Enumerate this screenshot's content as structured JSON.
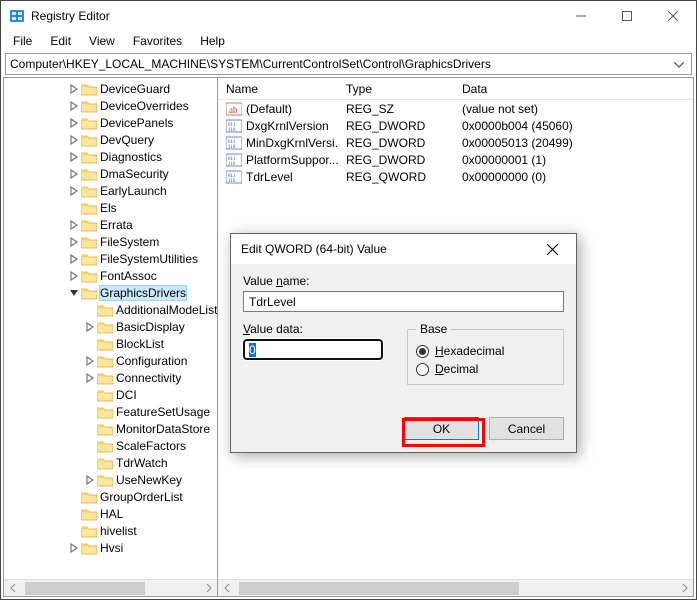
{
  "window": {
    "title": "Registry Editor"
  },
  "menu": {
    "file": "File",
    "edit": "Edit",
    "view": "View",
    "favorites": "Favorites",
    "help": "Help"
  },
  "address": "Computer\\HKEY_LOCAL_MACHINE\\SYSTEM\\CurrentControlSet\\Control\\GraphicsDrivers",
  "tree": [
    {
      "indent": 4,
      "label": "DeviceGuard",
      "twisty": "closed"
    },
    {
      "indent": 4,
      "label": "DeviceOverrides",
      "twisty": "closed"
    },
    {
      "indent": 4,
      "label": "DevicePanels",
      "twisty": "closed"
    },
    {
      "indent": 4,
      "label": "DevQuery",
      "twisty": "closed"
    },
    {
      "indent": 4,
      "label": "Diagnostics",
      "twisty": "closed"
    },
    {
      "indent": 4,
      "label": "DmaSecurity",
      "twisty": "closed"
    },
    {
      "indent": 4,
      "label": "EarlyLaunch",
      "twisty": "closed"
    },
    {
      "indent": 4,
      "label": "Els",
      "twisty": "none"
    },
    {
      "indent": 4,
      "label": "Errata",
      "twisty": "closed"
    },
    {
      "indent": 4,
      "label": "FileSystem",
      "twisty": "closed"
    },
    {
      "indent": 4,
      "label": "FileSystemUtilities",
      "twisty": "closed"
    },
    {
      "indent": 4,
      "label": "FontAssoc",
      "twisty": "closed"
    },
    {
      "indent": 4,
      "label": "GraphicsDrivers",
      "twisty": "open",
      "selected": true
    },
    {
      "indent": 5,
      "label": "AdditionalModeLists",
      "twisty": "none"
    },
    {
      "indent": 5,
      "label": "BasicDisplay",
      "twisty": "closed"
    },
    {
      "indent": 5,
      "label": "BlockList",
      "twisty": "none"
    },
    {
      "indent": 5,
      "label": "Configuration",
      "twisty": "closed"
    },
    {
      "indent": 5,
      "label": "Connectivity",
      "twisty": "closed"
    },
    {
      "indent": 5,
      "label": "DCI",
      "twisty": "none"
    },
    {
      "indent": 5,
      "label": "FeatureSetUsage",
      "twisty": "none"
    },
    {
      "indent": 5,
      "label": "MonitorDataStore",
      "twisty": "none"
    },
    {
      "indent": 5,
      "label": "ScaleFactors",
      "twisty": "none"
    },
    {
      "indent": 5,
      "label": "TdrWatch",
      "twisty": "none"
    },
    {
      "indent": 5,
      "label": "UseNewKey",
      "twisty": "closed"
    },
    {
      "indent": 4,
      "label": "GroupOrderList",
      "twisty": "none"
    },
    {
      "indent": 4,
      "label": "HAL",
      "twisty": "none"
    },
    {
      "indent": 4,
      "label": "hivelist",
      "twisty": "none"
    },
    {
      "indent": 4,
      "label": "Hvsi",
      "twisty": "closed"
    }
  ],
  "list": {
    "cols": {
      "name": "Name",
      "type": "Type",
      "data": "Data"
    },
    "rows": [
      {
        "icon": "str",
        "name": "(Default)",
        "type": "REG_SZ",
        "data": "(value not set)"
      },
      {
        "icon": "bin",
        "name": "DxgKrnlVersion",
        "type": "REG_DWORD",
        "data": "0x0000b004 (45060)"
      },
      {
        "icon": "bin",
        "name": "MinDxgKrnlVersi...",
        "type": "REG_DWORD",
        "data": "0x00005013 (20499)"
      },
      {
        "icon": "bin",
        "name": "PlatformSuppor...",
        "type": "REG_DWORD",
        "data": "0x00000001 (1)"
      },
      {
        "icon": "bin",
        "name": "TdrLevel",
        "type": "REG_QWORD",
        "data": "0x00000000 (0)"
      }
    ]
  },
  "dialog": {
    "title": "Edit QWORD (64-bit) Value",
    "value_name_label": "Value name:",
    "value_name": "TdrLevel",
    "value_data_label": "Value data:",
    "value_data": "0",
    "base_label": "Base",
    "hex_label": "Hexadecimal",
    "dec_label": "Decimal",
    "base_selected": "hex",
    "ok": "OK",
    "cancel": "Cancel"
  }
}
